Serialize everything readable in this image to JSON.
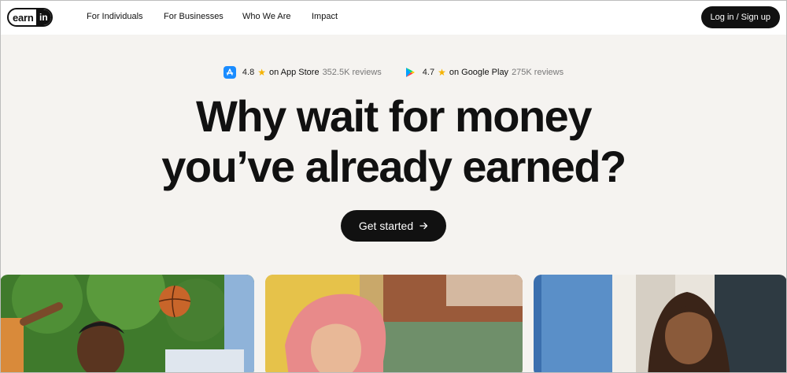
{
  "nav": {
    "logo_earn": "earn",
    "logo_in": "in",
    "links": [
      "For Individuals",
      "For Businesses",
      "Who We Are",
      "Impact"
    ],
    "login_label": "Log in / Sign up"
  },
  "ratings": [
    {
      "store_icon": "app-store-icon",
      "score": "4.8",
      "star_icon": "star-icon",
      "store": "on App Store",
      "reviews": "352.5K reviews"
    },
    {
      "store_icon": "google-play-icon",
      "score": "4.7",
      "star_icon": "star-icon",
      "store": "on Google Play",
      "reviews": "275K reviews"
    }
  ],
  "hero": {
    "line1": "Why wait for money",
    "line2": "you’ve already earned?",
    "cta_label": "Get started",
    "cta_icon": "arrow-right-icon"
  },
  "colors": {
    "background": "#f5f3f0",
    "nav_bg": "#ffffff",
    "button_bg": "#111111",
    "star": "#f5b301"
  }
}
